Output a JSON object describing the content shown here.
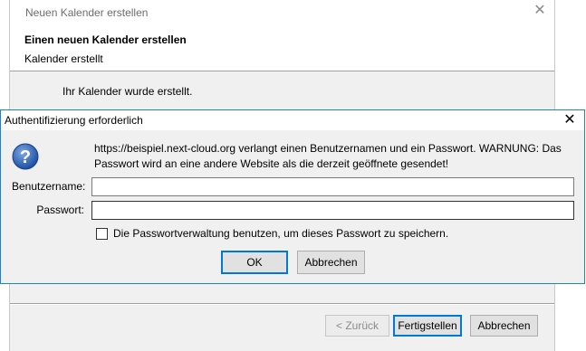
{
  "wizard": {
    "window_title": "Neuen Kalender erstellen",
    "heading": "Einen neuen Kalender erstellen",
    "subheading": "Kalender erstellt",
    "message": "Ihr Kalender wurde erstellt.",
    "back_label": "< Zurück",
    "finish_label": "Fertigstellen",
    "cancel_label": "Abbrechen",
    "close_glyph": "✕"
  },
  "auth": {
    "title": "Authentifizierung erforderlich",
    "close_glyph": "✕",
    "icon": "question-icon",
    "message": "https://beispiel.next-cloud.org verlangt einen Benutzernamen und ein Passwort. WARNUNG: Das Passwort wird an eine andere Website als die derzeit geöffnete gesendet!",
    "username_label": "Benutzername:",
    "username_value": "",
    "password_label": "Passwort:",
    "password_value": "",
    "remember_label": "Die Passwortverwaltung benutzen, um dieses Passwort zu speichern.",
    "remember_checked": false,
    "ok_label": "OK",
    "cancel_label": "Abbrechen",
    "accent_color": "#0078d7"
  }
}
